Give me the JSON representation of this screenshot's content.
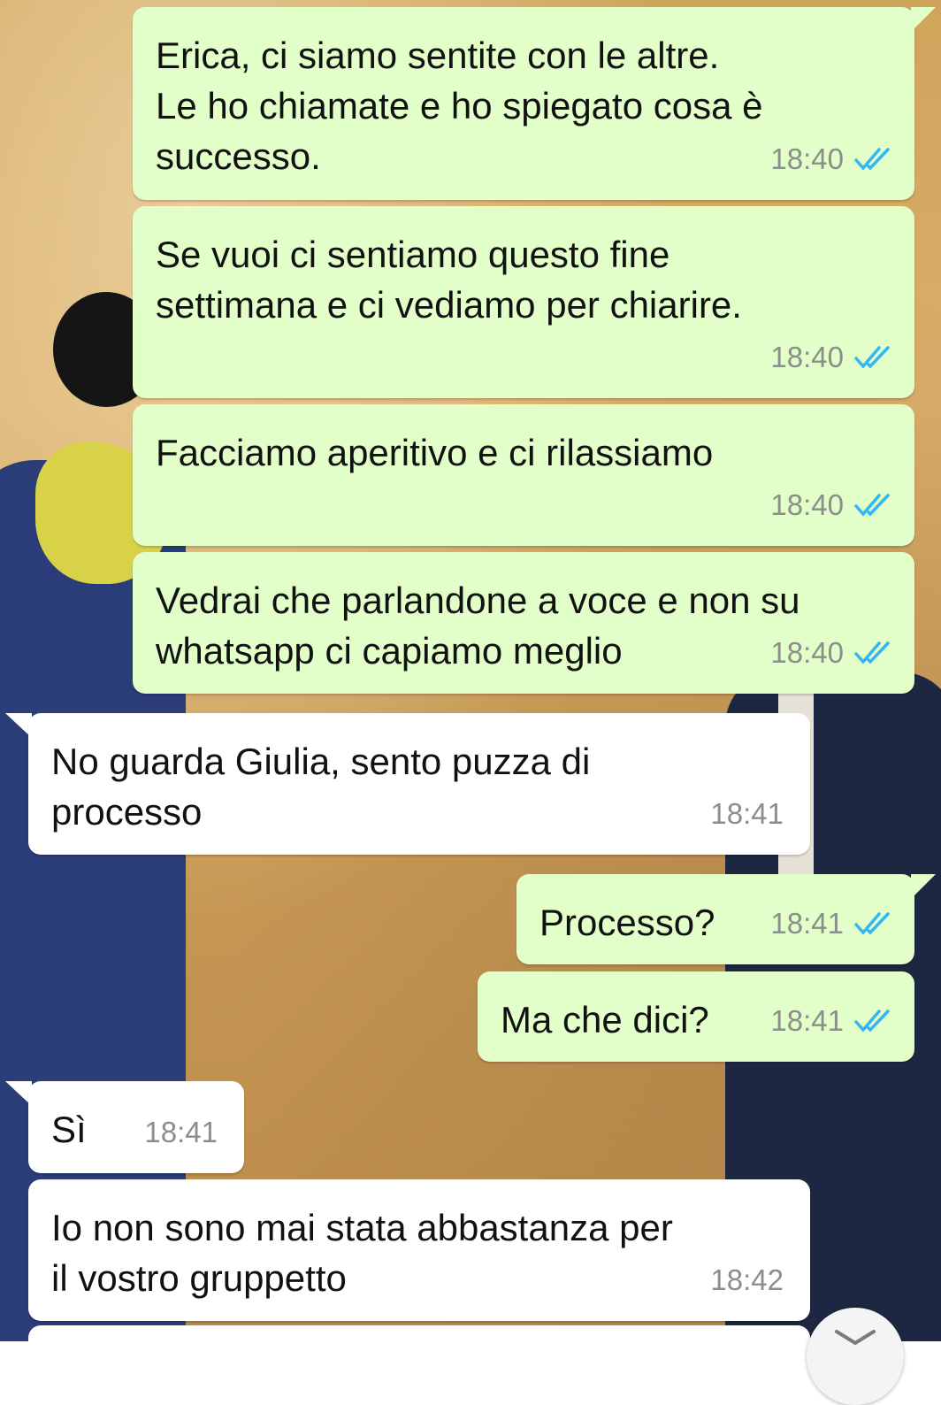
{
  "colors": {
    "outgoing_bubble": "#e2fec9",
    "incoming_bubble": "#ffffff",
    "read_ticks": "#34b7f1",
    "timestamp": "#8a8f8a"
  },
  "icons": {
    "read_receipt": "double-check-icon",
    "scroll_down": "chevron-down-icon"
  },
  "messages": [
    {
      "direction": "outgoing",
      "text": "Erica, ci siamo sentite con le altre.\nLe ho chiamate e ho spiegato cosa è\nsuccesso.",
      "time": "18:40"
    },
    {
      "direction": "outgoing",
      "text": "Se vuoi ci sentiamo questo fine\nsettimana e ci vediamo per chiarire.",
      "time": "18:40"
    },
    {
      "direction": "outgoing",
      "text": "Facciamo aperitivo e ci rilassiamo",
      "time": "18:40"
    },
    {
      "direction": "outgoing",
      "text": "Vedrai che parlandone a voce e non su\nwhatsapp ci capiamo meglio",
      "time": "18:40"
    },
    {
      "direction": "incoming",
      "text": "No guarda Giulia, sento puzza di\nprocesso",
      "time": "18:41"
    },
    {
      "direction": "outgoing",
      "text": "Processo?",
      "time": "18:41"
    },
    {
      "direction": "outgoing",
      "text": "Ma che dici?",
      "time": "18:41"
    },
    {
      "direction": "incoming",
      "text": "Sì",
      "time": "18:41"
    },
    {
      "direction": "incoming",
      "text": "Io non sono mai stata abbastanza per\nil vostro gruppetto",
      "time": "18:42"
    }
  ]
}
